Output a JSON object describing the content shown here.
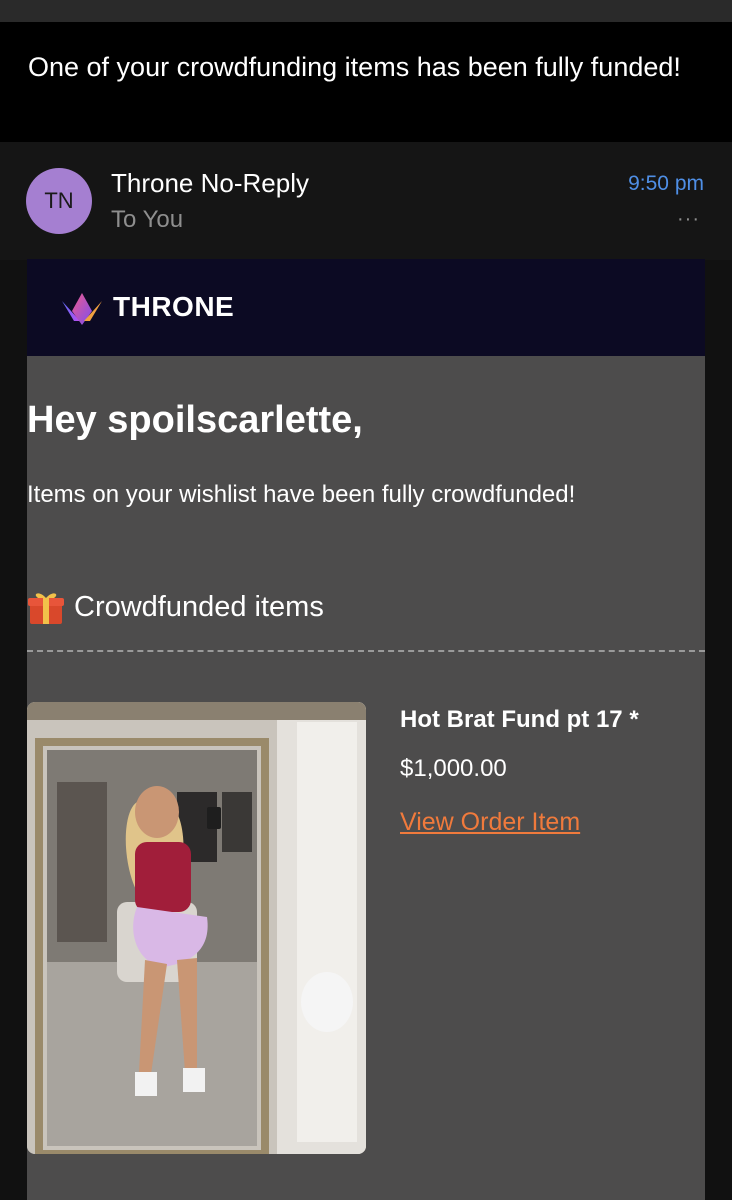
{
  "subject": "One of your crowdfunding items has been fully funded!",
  "header": {
    "avatar_initials": "TN",
    "sender": "Throne No-Reply",
    "recipient": "To You",
    "time": "9:50 pm",
    "more": "···"
  },
  "email": {
    "brand": "THRONE",
    "greeting": "Hey spoilscarlette,",
    "intro": "Items on your wishlist have been fully crowdfunded!",
    "section_title": "Crowdfunded items",
    "item": {
      "name": "Hot Brat Fund pt 17 *",
      "price": "$1,000.00",
      "link": "View Order Item"
    }
  },
  "colors": {
    "accent_link": "#f07a3c",
    "time_blue": "#4f8fe6",
    "avatar_purple": "#a57fd1",
    "brand_bar": "#0c0a23",
    "card_bg": "#4d4c4c"
  },
  "icons": {
    "section": "gift-icon",
    "brand": "crown-logo-icon",
    "more": "more-options-icon"
  }
}
